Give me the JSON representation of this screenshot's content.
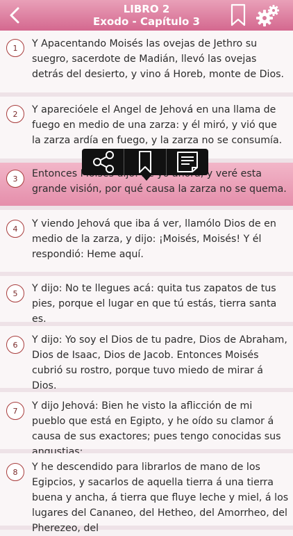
{
  "header": {
    "book": "LIBRO 2",
    "chapter": "Exodo - Capítulo 3",
    "colors": {
      "bar": "#d4688f",
      "text": "#ffffff"
    }
  },
  "icons": {
    "back": "back-arrow-icon",
    "bookmark": "bookmark-icon",
    "settings": "gear-icon",
    "share": "share-icon",
    "note": "note-icon"
  },
  "verses": [
    {
      "num": "1",
      "text": "Y Apacentando Moisés las ovejas de Jethro su suegro, sacerdote de Madián, llevó las ovejas detrás del desierto, y vino á Horeb, monte de Dios."
    },
    {
      "num": "2",
      "text": "Y aparecióele el Angel de Jehová en una llama de fuego en medio de una zarza: y él miró, y vió que la zarza ardía en fuego, y la zarza no se consumía."
    },
    {
      "num": "3",
      "text": "Entonces Moisés dijo: Iré yo ahora, y veré esta grande visión, por qué causa la zarza no se quema."
    },
    {
      "num": "4",
      "text": "Y viendo Jehová que iba á ver, llamólo Dios de en medio de la zarza, y dijo: ¡Moisés, Moisés! Y él respondió: Heme aquí."
    },
    {
      "num": "5",
      "text": "Y dijo: No te llegues acá: quita tus zapatos de tus pies, porque el lugar en que tú estás, tierra santa es."
    },
    {
      "num": "6",
      "text": "Y dijo: Yo soy el Dios de tu padre, Dios de Abraham, Dios de Isaac, Dios de Jacob. Entonces Moisés cubrió su rostro, porque tuvo miedo de mirar á Dios."
    },
    {
      "num": "7",
      "text": "Y dijo Jehová: Bien he visto la aflicción de mi pueblo que está en Egipto, y he oído su clamor á causa de sus exactores; pues tengo conocidas sus angustias:"
    },
    {
      "num": "8",
      "text": "Y he descendido para librarlos de mano de los Egipcios, y sacarlos de aquella tierra á una tierra buena y ancha, á tierra que fluye leche y miel, á los lugares del Cananeo, del Hetheo, del Amorrheo, del Pherezeo, del"
    }
  ]
}
